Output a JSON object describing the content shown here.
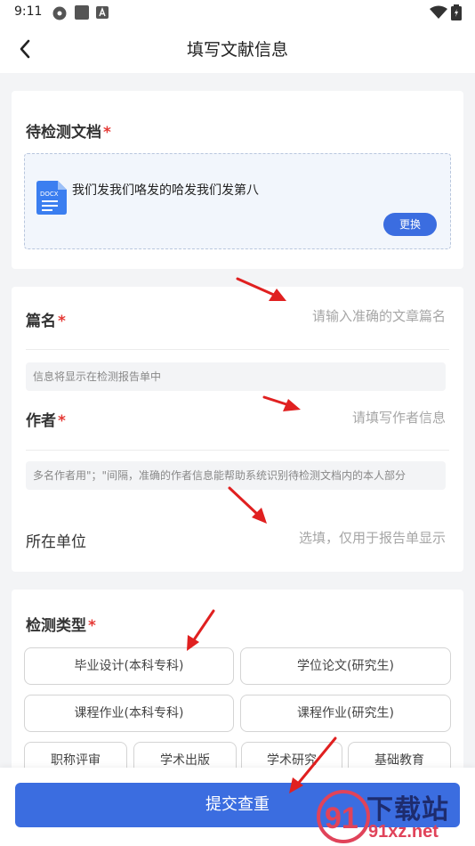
{
  "status_bar": {
    "time": "9:11"
  },
  "header": {
    "title": "填写文献信息"
  },
  "document_section": {
    "title": "待检测文档",
    "required_mark": "*",
    "file_name": "我们发我们咯发的哈发我们发第八",
    "file_badge": "DOCX",
    "replace_label": "更换"
  },
  "info_section": {
    "title_field": {
      "label": "篇名",
      "required_mark": "*",
      "placeholder": "请输入准确的文章篇名",
      "hint": "信息将显示在检测报告单中"
    },
    "author_field": {
      "label": "作者",
      "required_mark": "*",
      "placeholder": "请填写作者信息",
      "hint": "多名作者用\"；\"间隔，准确的作者信息能帮助系统识别待检测文档内的本人部分"
    },
    "unit_field": {
      "label": "所在单位",
      "placeholder": "选填，仅用于报告单显示"
    }
  },
  "type_section": {
    "title": "检测类型",
    "required_mark": "*",
    "options": [
      "毕业设计(本科专科)",
      "学位论文(研究生)",
      "课程作业(本科专科)",
      "课程作业(研究生)",
      "职称评审",
      "学术出版",
      "学术研究",
      "基础教育"
    ]
  },
  "submit_label": "提交查重",
  "watermark": {
    "text": "下载站",
    "url_text": "91xz.net",
    "logo_text": "91"
  },
  "colors": {
    "accent": "#3b6de0",
    "required": "#e53935",
    "annotation_arrow": "#e02020"
  }
}
